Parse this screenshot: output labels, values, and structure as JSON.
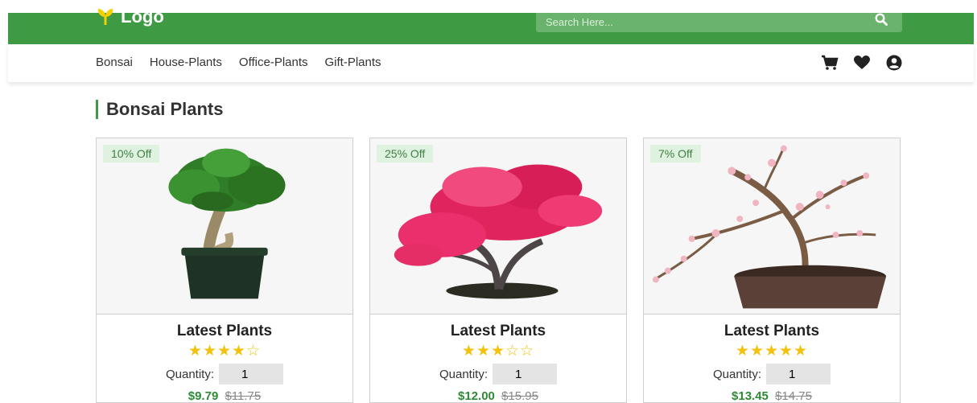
{
  "header": {
    "logo_text": "Logo",
    "search_placeholder": "Search Here...",
    "brand_color": "#3f9a44"
  },
  "nav": {
    "items": [
      {
        "label": "Bonsai"
      },
      {
        "label": "House-Plants"
      },
      {
        "label": "Office-Plants"
      },
      {
        "label": "Gift-Plants"
      }
    ],
    "icons": [
      "cart-icon",
      "heart-icon",
      "user-icon"
    ]
  },
  "section": {
    "title": "Bonsai Plants"
  },
  "products": [
    {
      "badge": "10% Off",
      "title": "Latest Plants",
      "rating": 4,
      "stars": "★★★★☆",
      "quantity_label": "Quantity:",
      "quantity": "1",
      "price_new": "$9.79",
      "price_old": "$11.75"
    },
    {
      "badge": "25% Off",
      "title": "Latest Plants",
      "rating": 3,
      "stars": "★★★☆☆",
      "quantity_label": "Quantity:",
      "quantity": "1",
      "price_new": "$12.00",
      "price_old": "$15.95"
    },
    {
      "badge": "7% Off",
      "title": "Latest Plants",
      "rating": 5,
      "stars": "★★★★★",
      "quantity_label": "Quantity:",
      "quantity": "1",
      "price_new": "$13.45",
      "price_old": "$14.75"
    }
  ]
}
